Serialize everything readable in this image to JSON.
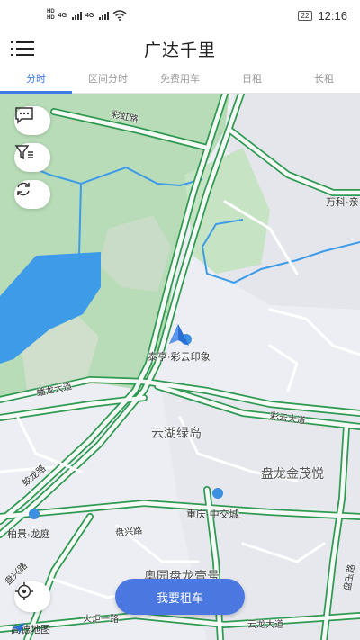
{
  "status_bar": {
    "sim1": "HD",
    "sim2": "HD",
    "net1": "4G",
    "net2": "4G",
    "battery": "22",
    "time": "12:16"
  },
  "header": {
    "title": "广达千里"
  },
  "tabs": [
    {
      "label": "分时",
      "active": true
    },
    {
      "label": "区间分时",
      "active": false
    },
    {
      "label": "免费用车",
      "active": false
    },
    {
      "label": "日租",
      "active": false
    },
    {
      "label": "长租",
      "active": false
    }
  ],
  "map": {
    "labels": {
      "caihong_road": "彩虹路",
      "wanke": "万科·亲",
      "taiheng": "泰亨·彩云印象",
      "panlong_ave": "蟠龙大道",
      "caiyun_ave": "彩云大道",
      "yunhu": "云湖绿岛",
      "panlong_jinmao": "盘龙金茂悦",
      "jiaolong_road": "蛟龙路",
      "chongqing_zhongjiao": "重庆·中交城",
      "baijing": "柏景·龙庭",
      "panxing_road_1": "盘兴路",
      "panxing_road_2": "盘兴路",
      "aoyuan": "奥园盘龙壹号",
      "panyu_road": "盘玉路",
      "huoju_road": "火炬一路",
      "yunlong_ave": "云龙大道"
    },
    "attribution": "高德地图",
    "colors": {
      "road_outline": "#2e9a52",
      "park": "#b8dcb7",
      "water": "#3d9be8",
      "background": "#eceef3"
    }
  },
  "actions": {
    "rent_button": "我要租车"
  },
  "icons": {
    "menu": "menu-icon",
    "message": "message-icon",
    "filter": "filter-icon",
    "refresh": "refresh-icon",
    "locate": "locate-icon",
    "car_marker": "car-marker-icon"
  }
}
